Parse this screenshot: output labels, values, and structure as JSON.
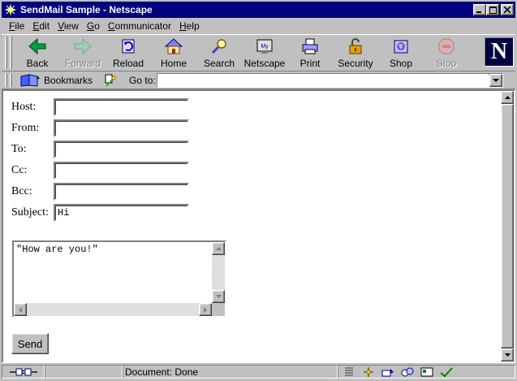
{
  "window": {
    "title": "SendMail Sample - Netscape",
    "controls": [
      "minimize",
      "maximize",
      "close"
    ]
  },
  "menu": [
    "File",
    "Edit",
    "View",
    "Go",
    "Communicator",
    "Help"
  ],
  "toolbar": {
    "buttons": [
      {
        "label": "Back",
        "icon": "back-arrow-icon",
        "enabled": true
      },
      {
        "label": "Forward",
        "icon": "forward-arrow-icon",
        "enabled": false
      },
      {
        "label": "Reload",
        "icon": "reload-icon",
        "enabled": true
      },
      {
        "label": "Home",
        "icon": "home-icon",
        "enabled": true
      },
      {
        "label": "Search",
        "icon": "search-icon",
        "enabled": true
      },
      {
        "label": "Netscape",
        "icon": "netscape-icon",
        "enabled": true
      },
      {
        "label": "Print",
        "icon": "print-icon",
        "enabled": true
      },
      {
        "label": "Security",
        "icon": "security-lock-icon",
        "enabled": true
      },
      {
        "label": "Shop",
        "icon": "shop-icon",
        "enabled": true
      },
      {
        "label": "Stop",
        "icon": "stop-icon",
        "enabled": false
      }
    ],
    "logo_letter": "N"
  },
  "location": {
    "bookmarks_label": "Bookmarks",
    "goto_label": "Go to:",
    "url": ""
  },
  "form": {
    "fields": [
      {
        "label": "Host:",
        "value": ""
      },
      {
        "label": "From:",
        "value": ""
      },
      {
        "label": "To:",
        "value": ""
      },
      {
        "label": "Cc:",
        "value": ""
      },
      {
        "label": "Bcc:",
        "value": ""
      },
      {
        "label": "Subject:",
        "value": "Hi"
      }
    ],
    "message": "\"How are you!\"",
    "send_label": "Send"
  },
  "status": {
    "text": "Document: Done"
  },
  "colors": {
    "titlebar": "#000080",
    "chrome": "#c0c0c0",
    "content_bg": "#ffffff"
  }
}
